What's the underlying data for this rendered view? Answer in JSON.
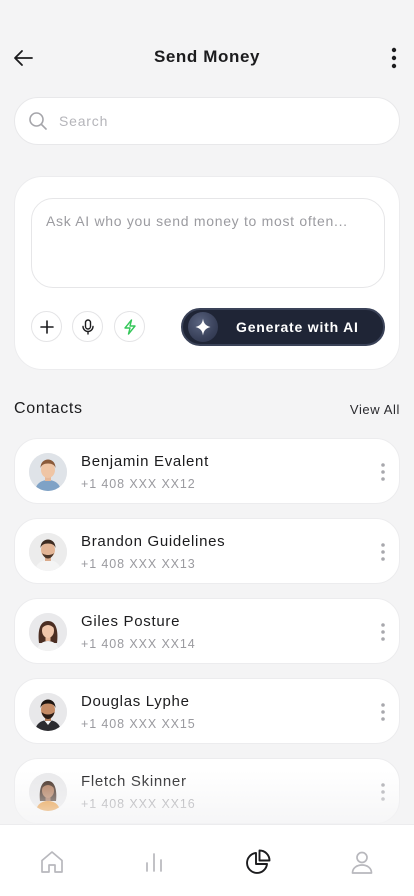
{
  "header": {
    "title": "Send Money"
  },
  "search": {
    "placeholder": "Search"
  },
  "ai": {
    "prompt_placeholder": "Ask AI who you send money to most often...",
    "generate_label": "Generate with AI"
  },
  "contacts": {
    "title": "Contacts",
    "view_all": "View All",
    "items": [
      {
        "name": "Benjamin Evalent",
        "phone": "+1 408 XXX XX12"
      },
      {
        "name": "Brandon Guidelines",
        "phone": "+1 408 XXX XX13"
      },
      {
        "name": "Giles Posture",
        "phone": "+1 408 XXX XX14"
      },
      {
        "name": "Douglas Lyphe",
        "phone": "+1 408 XXX XX15"
      },
      {
        "name": "Fletch Skinner",
        "phone": "+1 408 XXX XX16"
      }
    ]
  },
  "tabs": [
    {
      "icon": "home-icon",
      "active": false
    },
    {
      "icon": "stats-icon",
      "active": false
    },
    {
      "icon": "pie-chart-icon",
      "active": true
    },
    {
      "icon": "profile-icon",
      "active": false
    }
  ],
  "colors": {
    "background": "#f4f4f5",
    "card": "#ffffff",
    "accent_dark": "#1f2536",
    "lightning_green": "#34c759",
    "text_primary": "#1c1c1e",
    "text_secondary": "#9a9a9f"
  }
}
